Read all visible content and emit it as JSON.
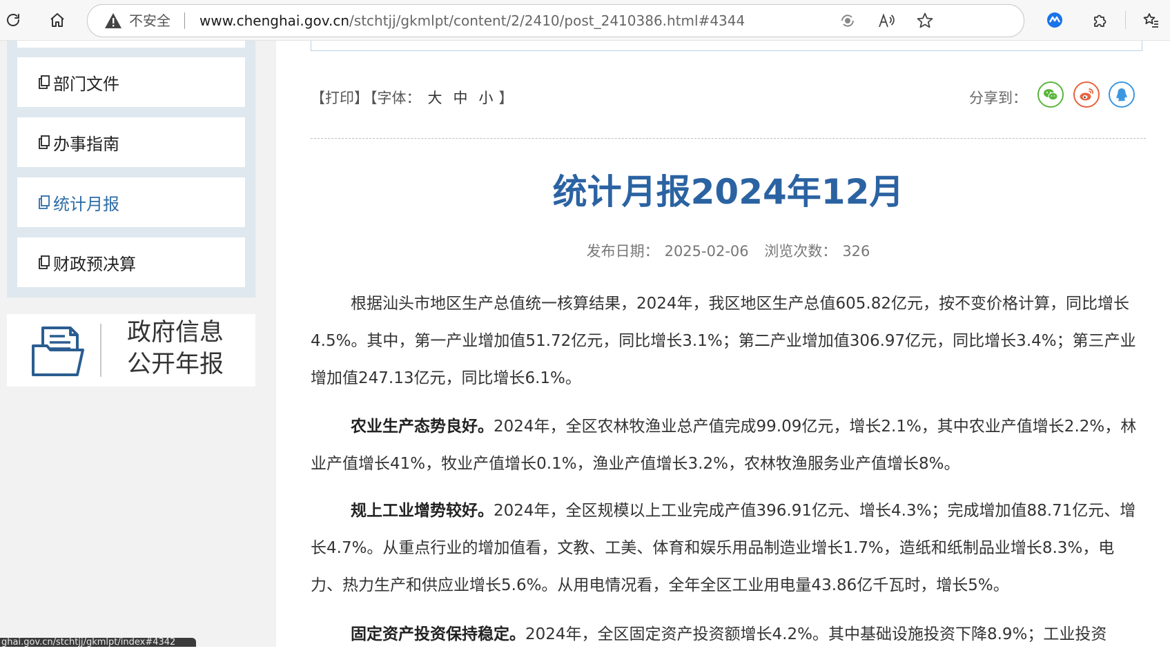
{
  "browser": {
    "security_label": "不安全",
    "url_host": "www.chenghai.gov.cn",
    "url_path": "/stchtjj/gkmlpt/content/2/2410/post_2410386.html#4344",
    "status_bar_link": "ghai.gov.cn/stchtjj/gkmlpt/index#4342",
    "icons": [
      "refresh-icon",
      "home-icon",
      "warning-icon",
      "tracking-icon",
      "read-aloud-icon",
      "favorite-star-icon",
      "extension-blue-icon",
      "extensions-puzzle-icon",
      "favorites-list-icon"
    ]
  },
  "sidebar": {
    "items": [
      {
        "label": "部门文件",
        "active": false
      },
      {
        "label": "办事指南",
        "active": false
      },
      {
        "label": "统计月报",
        "active": true
      },
      {
        "label": "财政预决算",
        "active": false
      }
    ],
    "annual_report": {
      "line1": "政府信息",
      "line2": "公开年报"
    }
  },
  "tools": {
    "print": "【打印】",
    "font_prefix": "【字体：",
    "font_large": "大",
    "font_medium": "中",
    "font_small": "小",
    "font_suffix": "】",
    "share_label": "分享到："
  },
  "article": {
    "title": "统计月报2024年12月",
    "publish_label": "发布日期：",
    "publish_date": "2025-02-06",
    "views_label": "浏览次数：",
    "views": "326",
    "paragraphs": [
      {
        "lead": "",
        "text": "根据汕头市地区生产总值统一核算结果，2024年，我区地区生产总值605.82亿元，按不变价格计算，同比增长4.5%。其中，第一产业增加值51.72亿元，同比增长3.1%；第二产业增加值306.97亿元，同比增长3.4%；第三产业增加值247.13亿元，同比增长6.1%。"
      },
      {
        "lead": "农业生产态势良好。",
        "text": "2024年，全区农林牧渔业总产值完成99.09亿元，增长2.1%，其中农业产值增长2.2%，林业产值增长41%，牧业产值增长0.1%，渔业产值增长3.2%，农林牧渔服务业产值增长8%。"
      },
      {
        "lead": "规上工业增势较好。",
        "text": "2024年，全区规模以上工业完成产值396.91亿元、增长4.3%；完成增加值88.71亿元、增长4.7%。从重点行业的增加值看，文教、工美、体育和娱乐用品制造业增长1.7%，造纸和纸制品业增长8.3%，电力、热力生产和供应业增长5.6%。从用电情况看，全年全区工业用电量43.86亿千瓦时，增长5%。"
      },
      {
        "lead": "固定资产投资保持稳定。",
        "text": "2024年，全区固定资产投资额增长4.2%。其中基础设施投资下降8.9%；工业投资"
      }
    ]
  }
}
